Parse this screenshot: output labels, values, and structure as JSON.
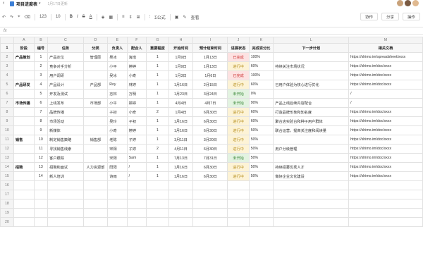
{
  "app": {
    "back_glyph": "‹",
    "doc_icon": "doc-icon",
    "title": "项目进度表",
    "title_caret": "▾",
    "saved_text": "1月17日更新",
    "avatars": [
      "#c9a27a",
      "#7a5a42",
      "#e0b990"
    ]
  },
  "toolbar": {
    "undo": "↶",
    "redo": "↷",
    "format_painter": "⌖",
    "clear": "⌫",
    "number_format": "123",
    "font_size": "10",
    "bold": "B",
    "italic": "I",
    "strike": "S",
    "font_color": "A",
    "fill": "◈",
    "borders": "▦",
    "align": "≡",
    "valign": "⇕",
    "merge": "⊞",
    "filter": "⫶",
    "formula": "Σ公式",
    "image": "▣",
    "comment": "✎",
    "view": "查看",
    "collab_label": "协作",
    "share_label": "分享",
    "more_label": "操作"
  },
  "formula_bar": {
    "fx": "fx",
    "value": ""
  },
  "columns": [
    "A",
    "B",
    "C",
    "D",
    "E",
    "F",
    "G",
    "H",
    "I",
    "J",
    "K",
    "L",
    "M"
  ],
  "header": [
    "阶段",
    "编号",
    "任务",
    "分类",
    "负责人",
    "配合人",
    "重要程度",
    "开始时间",
    "预计结束时间",
    "进展状态",
    "完成百分比",
    "下一步计划",
    "相关文档"
  ],
  "rows": [
    {
      "n": "2",
      "a": "产品策划",
      "b": "1",
      "c": "产品定位",
      "d": "管理层",
      "e": "吴冰",
      "f": "海浩",
      "g": "1",
      "h": "1月9日",
      "i": "1月13日",
      "j": "已完成",
      "k": "100%",
      "l": "",
      "m": "https://shimo.im/spreadsheet/xxxx",
      "st": "done"
    },
    {
      "n": "3",
      "a": "",
      "b": "2",
      "c": "竞争对手分析",
      "d": "",
      "e": "小平",
      "f": "婷婷",
      "g": "1",
      "h": "1月9日",
      "i": "1月13日",
      "j": "进行中",
      "k": "60%",
      "l": "持续关注市场状况",
      "m": "https://shimo.im/doc/xxxx",
      "st": "prog"
    },
    {
      "n": "4",
      "a": "",
      "b": "3",
      "c": "用户调研",
      "d": "",
      "e": "吴冰",
      "f": "小奇",
      "g": "1",
      "h": "1月3日",
      "i": "1月6日",
      "j": "已完成",
      "k": "100%",
      "l": "",
      "m": "https://shimo.im/doc/xxxx",
      "st": "done"
    },
    {
      "n": "5",
      "a": "产品研发",
      "b": "4",
      "c": "产品设计",
      "d": "产品部",
      "e": "Roy",
      "f": "林婷",
      "g": "1",
      "h": "1月16日",
      "i": "2月15日",
      "j": "进行中",
      "k": "60%",
      "l": "已用户体验为核心进行优化",
      "m": "https://shimo.im/doc/xxxx",
      "st": "prog"
    },
    {
      "n": "6",
      "a": "",
      "b": "5",
      "c": "开发及测试",
      "d": "",
      "e": "志林",
      "f": "万明",
      "g": "1",
      "h": "1月23日",
      "i": "3月24日",
      "j": "未开始",
      "k": "0%",
      "l": "",
      "m": "/",
      "st": "todo"
    },
    {
      "n": "7",
      "a": "市场传播",
      "b": "6",
      "c": "上线发布",
      "d": "市场部",
      "e": "小平",
      "f": "婷婷",
      "g": "1",
      "h": "4月4日",
      "i": "4月7日",
      "j": "未开始",
      "k": "90%",
      "l": "产品上线后续内容配合",
      "m": "/",
      "st": "todo"
    },
    {
      "n": "8",
      "a": "",
      "b": "7",
      "c": "品牌传播",
      "d": "",
      "e": "子初",
      "f": "小奇",
      "g": "2",
      "h": "1月4日",
      "i": "6月30日",
      "j": "进行中",
      "k": "60%",
      "l": "打造品牌形象和知名度",
      "m": "https://shimo.im/doc/xxxx",
      "st": "prog"
    },
    {
      "n": "9",
      "a": "",
      "b": "8",
      "c": "市场活动",
      "d": "",
      "e": "吴玲",
      "f": "子初",
      "g": "1",
      "h": "1月16日",
      "i": "6月30日",
      "j": "进行中",
      "k": "60%",
      "l": "聚合店实验台和种子用户群体",
      "m": "https://shimo.im/doc/xxxx",
      "st": "prog"
    },
    {
      "n": "10",
      "a": "",
      "b": "9",
      "c": "新媒体",
      "d": "",
      "e": "小奇",
      "f": "婷婷",
      "g": "1",
      "h": "1月16日",
      "i": "6月30日",
      "j": "进行中",
      "k": "50%",
      "l": "联合运营，提高关注度和阅读量",
      "m": "https://shimo.im/doc/xxxx",
      "st": "prog"
    },
    {
      "n": "11",
      "a": "销售",
      "b": "10",
      "c": "制定销售策略",
      "d": "销售部",
      "e": "老陈",
      "f": "子婷",
      "g": "1",
      "h": "3月11日",
      "i": "3月20日",
      "j": "进行中",
      "k": "50%",
      "l": "",
      "m": "https://shimo.im/doc/xxxx",
      "st": "prog"
    },
    {
      "n": "12",
      "a": "",
      "b": "11",
      "c": "寻找销售线索",
      "d": "",
      "e": "宋阳",
      "f": "子婷",
      "g": "2",
      "h": "4月11日",
      "i": "6月30日",
      "j": "进行中",
      "k": "50%",
      "l": "用户分级管理",
      "m": "https://shimo.im/doc/xxxx",
      "st": "prog"
    },
    {
      "n": "13",
      "a": "",
      "b": "12",
      "c": "客户跟踪",
      "d": "",
      "e": "宋阳",
      "f": "Sam",
      "g": "1",
      "h": "7月13日",
      "i": "7月31日",
      "j": "未开始",
      "k": "50%",
      "l": "",
      "m": "https://shimo.im/doc/xxxx",
      "st": "todo"
    },
    {
      "n": "14",
      "a": "招聘",
      "b": "13",
      "c": "招聘和面试",
      "d": "人力资源部",
      "e": "阳阳",
      "f": "/",
      "g": "1",
      "h": "1月16日",
      "i": "6月30日",
      "j": "进行中",
      "k": "50%",
      "l": "持续招募优秀人才",
      "m": "https://shimo.im/doc/xxxx",
      "st": "prog"
    },
    {
      "n": "15",
      "a": "",
      "b": "14",
      "c": "新人培训",
      "d": "",
      "e": "诗雨",
      "f": "/",
      "g": "1",
      "h": "1月16日",
      "i": "6月30日",
      "j": "进行中",
      "k": "50%",
      "l": "做好企业文化建设",
      "m": "https://shimo.im/doc/xxxx",
      "st": "prog"
    }
  ],
  "empty_rows": [
    "16",
    "17",
    "18",
    "19",
    "20"
  ]
}
